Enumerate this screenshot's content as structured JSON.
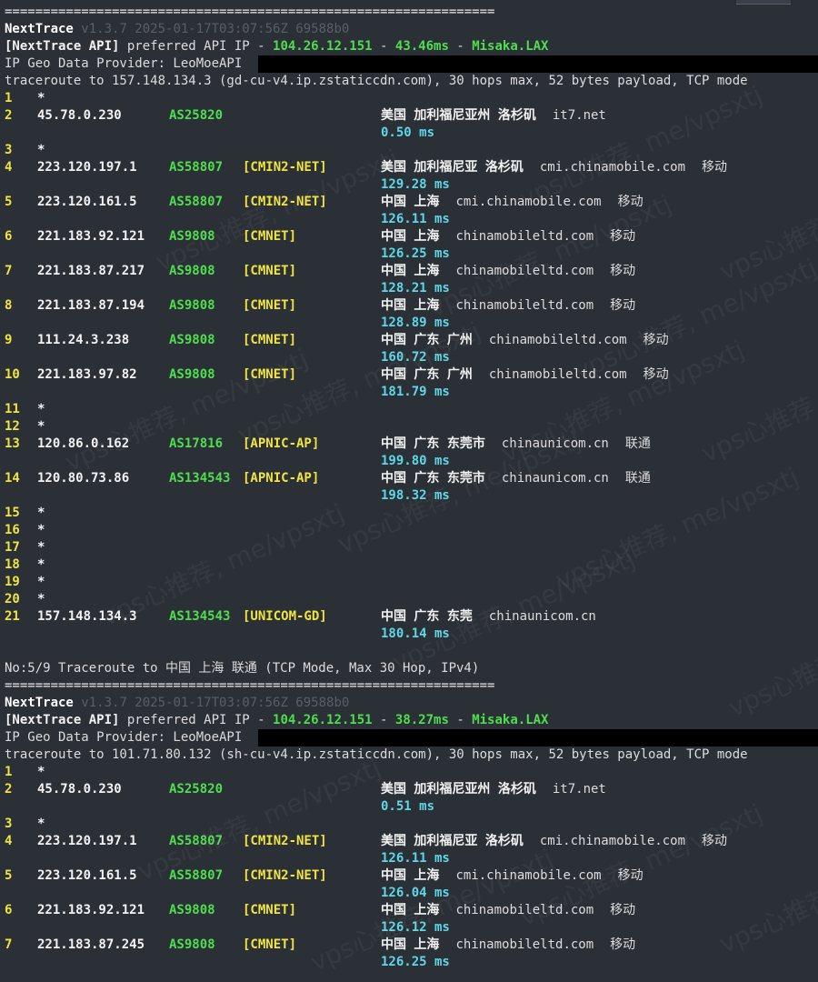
{
  "session1": {
    "separator": "================================================================",
    "tool": "NextTrace",
    "version": "v1.3.7 2025-01-17T03:07:56Z 69588b0",
    "api_label": "[NextTrace API]",
    "api_text": "preferred API IP -",
    "api_ip": "104.26.12.151",
    "dash": "-",
    "latency": "43.46ms",
    "node": "Misaka.LAX",
    "geo_provider": "IP Geo Data Provider: LeoMoeAPI",
    "trace_header": "traceroute to 157.148.134.3 (gd-cu-v4.ip.zstaticcdn.com), 30 hops max, 52 bytes payload, TCP mode",
    "hops": [
      {
        "n": "1",
        "ip": "*"
      },
      {
        "n": "2",
        "ip": "45.78.0.230",
        "asn": "AS25820",
        "tag": "",
        "geo": "美国 加利福尼亚州 洛杉矶",
        "domain": "it7.net",
        "isp": "",
        "rtt": "0.50 ms"
      },
      {
        "n": "3",
        "ip": "*"
      },
      {
        "n": "4",
        "ip": "223.120.197.1",
        "asn": "AS58807",
        "tag": "[CMIN2-NET]",
        "geo": "美国 加利福尼亚 洛杉矶",
        "domain": "cmi.chinamobile.com",
        "isp": "移动",
        "rtt": "129.28 ms"
      },
      {
        "n": "5",
        "ip": "223.120.161.5",
        "asn": "AS58807",
        "tag": "[CMIN2-NET]",
        "geo": "中国 上海",
        "domain": "cmi.chinamobile.com",
        "isp": "移动",
        "rtt": "126.11 ms"
      },
      {
        "n": "6",
        "ip": "221.183.92.121",
        "asn": "AS9808",
        "tag": "[CMNET]",
        "geo": "中国 上海",
        "domain": "chinamobileltd.com",
        "isp": "移动",
        "rtt": "126.25 ms"
      },
      {
        "n": "7",
        "ip": "221.183.87.217",
        "asn": "AS9808",
        "tag": "[CMNET]",
        "geo": "中国 上海",
        "domain": "chinamobileltd.com",
        "isp": "移动",
        "rtt": "128.21 ms"
      },
      {
        "n": "8",
        "ip": "221.183.87.194",
        "asn": "AS9808",
        "tag": "[CMNET]",
        "geo": "中国 上海",
        "domain": "chinamobileltd.com",
        "isp": "移动",
        "rtt": "128.89 ms"
      },
      {
        "n": "9",
        "ip": "111.24.3.238",
        "asn": "AS9808",
        "tag": "[CMNET]",
        "geo": "中国 广东 广州",
        "domain": "chinamobileltd.com",
        "isp": "移动",
        "rtt": "160.72 ms"
      },
      {
        "n": "10",
        "ip": "221.183.97.82",
        "asn": "AS9808",
        "tag": "[CMNET]",
        "geo": "中国 广东 广州",
        "domain": "chinamobileltd.com",
        "isp": "移动",
        "rtt": "181.79 ms"
      },
      {
        "n": "11",
        "ip": "*"
      },
      {
        "n": "12",
        "ip": "*"
      },
      {
        "n": "13",
        "ip": "120.86.0.162",
        "asn": "AS17816",
        "tag": "[APNIC-AP]",
        "geo": "中国 广东 东莞市",
        "domain": "chinaunicom.cn",
        "isp": "联通",
        "rtt": "199.80 ms"
      },
      {
        "n": "14",
        "ip": "120.80.73.86",
        "asn": "AS134543",
        "tag": "[APNIC-AP]",
        "geo": "中国 广东 东莞市",
        "domain": "chinaunicom.cn",
        "isp": "联通",
        "rtt": "198.32 ms"
      },
      {
        "n": "15",
        "ip": "*"
      },
      {
        "n": "16",
        "ip": "*"
      },
      {
        "n": "17",
        "ip": "*"
      },
      {
        "n": "18",
        "ip": "*"
      },
      {
        "n": "19",
        "ip": "*"
      },
      {
        "n": "20",
        "ip": "*"
      },
      {
        "n": "21",
        "ip": "157.148.134.3",
        "asn": "AS134543",
        "tag": "[UNICOM-GD]",
        "geo": "中国 广东 东莞",
        "domain": "chinaunicom.cn",
        "isp": "",
        "rtt": "180.14 ms"
      }
    ]
  },
  "section_title": "No:5/9 Traceroute to 中国 上海 联通 (TCP Mode, Max 30 Hop, IPv4)",
  "session2": {
    "separator": "================================================================",
    "tool": "NextTrace",
    "version": "v1.3.7 2025-01-17T03:07:56Z 69588b0",
    "api_label": "[NextTrace API]",
    "api_text": "preferred API IP -",
    "api_ip": "104.26.12.151",
    "dash": "-",
    "latency": "38.27ms",
    "node": "Misaka.LAX",
    "geo_provider": "IP Geo Data Provider: LeoMoeAPI",
    "trace_header": "traceroute to 101.71.80.132 (sh-cu-v4.ip.zstaticcdn.com), 30 hops max, 52 bytes payload, TCP mode",
    "hops": [
      {
        "n": "1",
        "ip": "*"
      },
      {
        "n": "2",
        "ip": "45.78.0.230",
        "asn": "AS25820",
        "tag": "",
        "geo": "美国 加利福尼亚州 洛杉矶",
        "domain": "it7.net",
        "isp": "",
        "rtt": "0.51 ms"
      },
      {
        "n": "3",
        "ip": "*"
      },
      {
        "n": "4",
        "ip": "223.120.197.1",
        "asn": "AS58807",
        "tag": "[CMIN2-NET]",
        "geo": "美国 加利福尼亚 洛杉矶",
        "domain": "cmi.chinamobile.com",
        "isp": "移动",
        "rtt": "126.11 ms"
      },
      {
        "n": "5",
        "ip": "223.120.161.5",
        "asn": "AS58807",
        "tag": "[CMIN2-NET]",
        "geo": "中国 上海",
        "domain": "cmi.chinamobile.com",
        "isp": "移动",
        "rtt": "126.04 ms"
      },
      {
        "n": "6",
        "ip": "221.183.92.121",
        "asn": "AS9808",
        "tag": "[CMNET]",
        "geo": "中国 上海",
        "domain": "chinamobileltd.com",
        "isp": "移动",
        "rtt": "126.12 ms"
      },
      {
        "n": "7",
        "ip": "221.183.87.245",
        "asn": "AS9808",
        "tag": "[CMNET]",
        "geo": "中国 上海",
        "domain": "chinamobileltd.com",
        "isp": "移动",
        "rtt": "126.25 ms"
      }
    ]
  },
  "watermark": "vps心推荐, me/vpsxtj"
}
